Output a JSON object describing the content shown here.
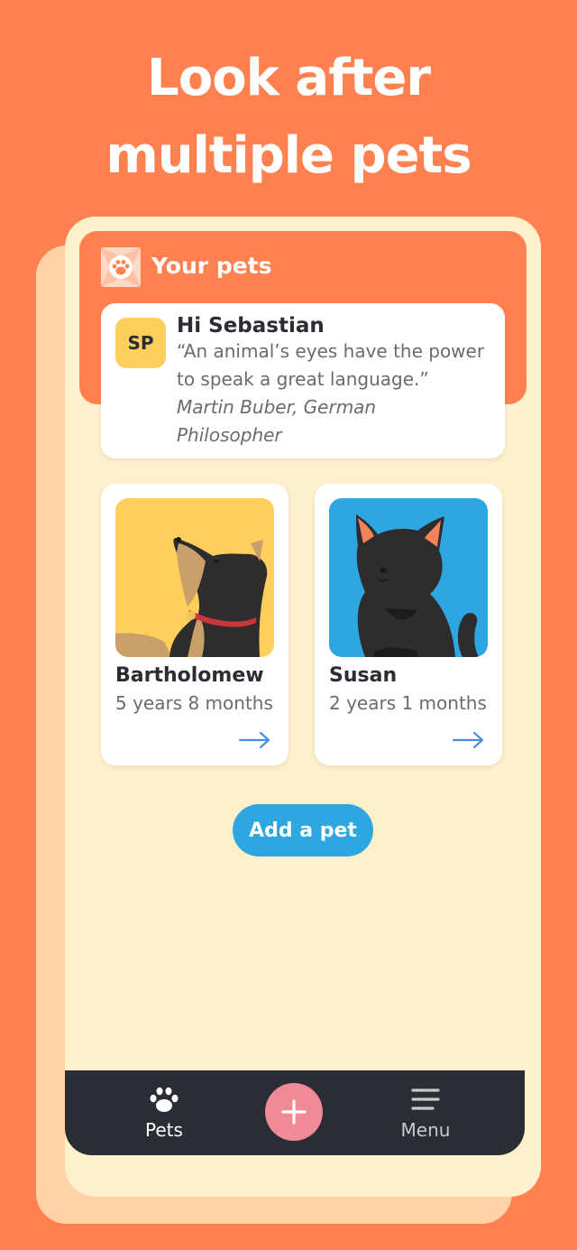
{
  "headline": {
    "line1": "Look after",
    "line2": "multiple pets"
  },
  "header": {
    "title": "Your pets",
    "logo_icon": "paw-logo-icon"
  },
  "greeting": {
    "initials": "SP",
    "title": "Hi Sebastian",
    "quote": "“An animal’s eyes have the power to speak a great language.”",
    "author": "Martin Buber, German Philosopher"
  },
  "pets": [
    {
      "name": "Bartholomew",
      "age": "5 years 8 months",
      "photo_bg": "#ffcf5c",
      "icon": "arrow-right-icon"
    },
    {
      "name": "Susan",
      "age": "2 years 1 months",
      "photo_bg": "#2ea6df",
      "icon": "arrow-right-icon"
    }
  ],
  "actions": {
    "add_pet": "Add a pet"
  },
  "tabbar": {
    "pets_label": "Pets",
    "menu_label": "Menu",
    "add_icon": "plus-icon"
  },
  "colors": {
    "background": "#ff8150",
    "card": "#fff0cc",
    "accent_blue": "#2ea6df",
    "tabbar": "#2a2d34",
    "fab": "#f08a94"
  }
}
